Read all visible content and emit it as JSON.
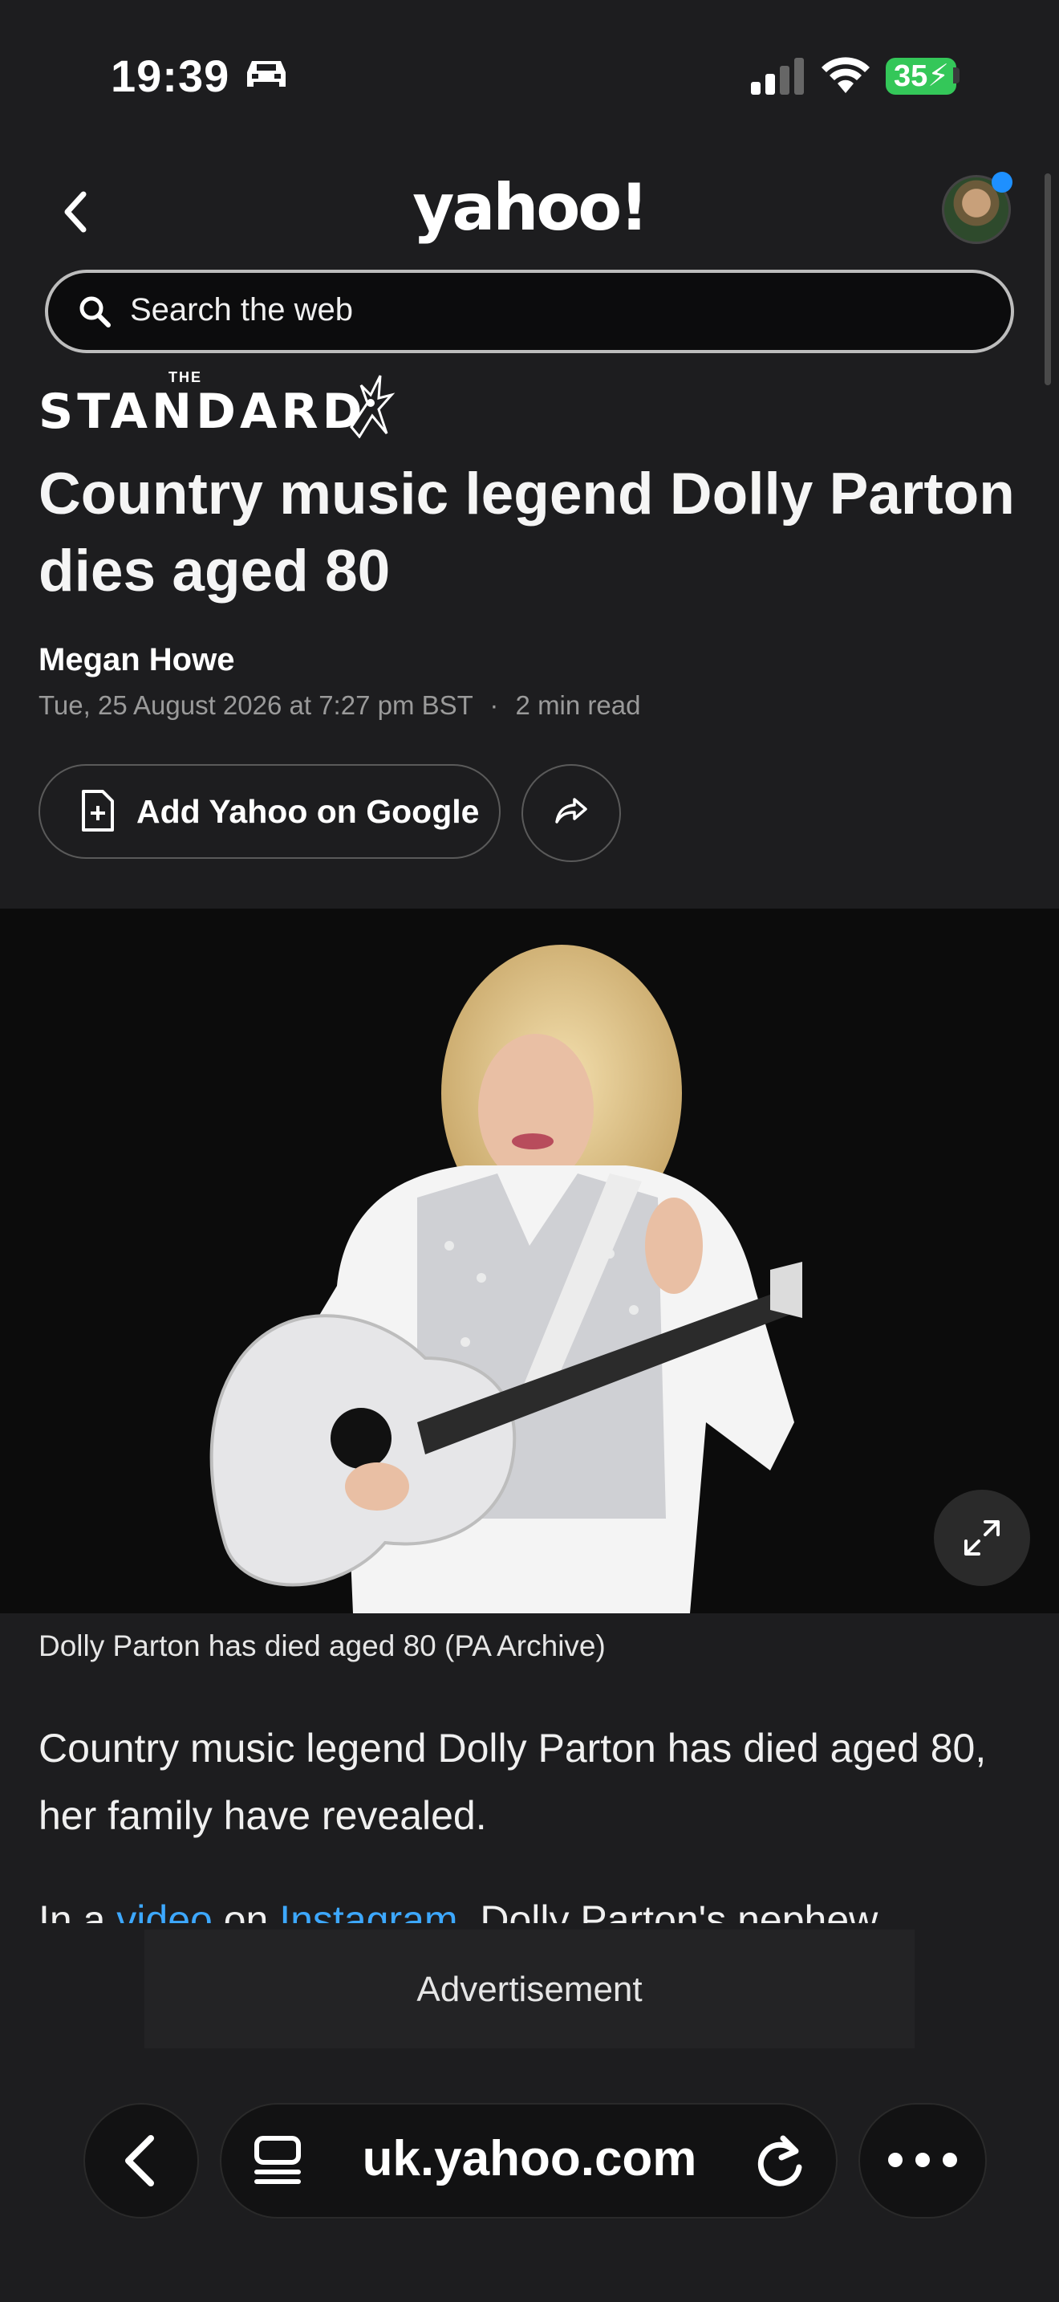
{
  "status_bar": {
    "time": "19:39",
    "battery": "35",
    "icons": [
      "car-icon",
      "signal-icon",
      "wifi-icon",
      "battery-icon"
    ]
  },
  "header": {
    "logo": "yahoo!",
    "search_placeholder": "Search the web"
  },
  "publisher": {
    "the": "THE",
    "name": "STANDARD"
  },
  "article": {
    "headline": "Country music legend Dolly Parton dies aged 80",
    "author": "Megan Howe",
    "date": "Tue, 25 August 2026 at 7:27 pm BST",
    "separator": "·",
    "read_time": "2 min read",
    "add_google_label": "Add Yahoo on Google",
    "caption": "Dolly Parton has died aged 80 (PA Archive)",
    "paragraph1": "Country music legend Dolly Parton has died aged 80, her family have revealed.",
    "p2_prefix": "In a ",
    "p2_link1": "video",
    "p2_mid": " on ",
    "p2_link2": "Instagram",
    "p2_suffix": ", Dolly Parton's nephew"
  },
  "ad": {
    "label": "Advertisement"
  },
  "bottom_bar": {
    "url": "uk.yahoo.com"
  },
  "colors": {
    "link": "#3da8ff",
    "battery": "#34c759",
    "background": "#1d1d1f"
  }
}
